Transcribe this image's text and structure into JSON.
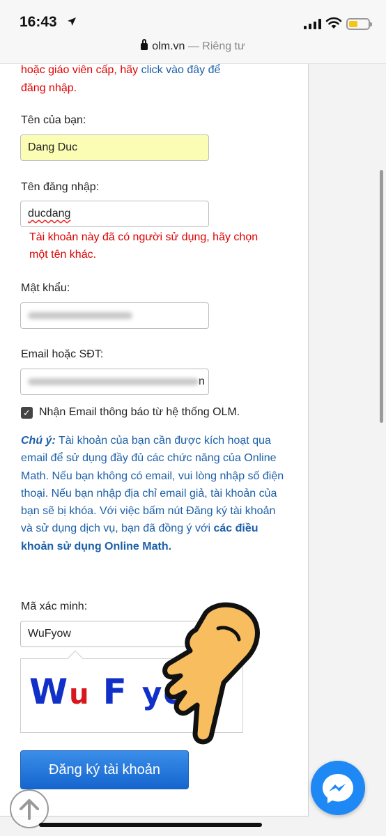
{
  "status": {
    "time": "16:43"
  },
  "browser": {
    "domain": "olm.vn",
    "suffix": "— Riêng tư"
  },
  "form": {
    "intro_prefix": "hoặc giáo viên cấp, hãy ",
    "intro_link": "click vào đây để",
    "intro_line2": "đăng nhập.",
    "name_label": "Tên của bạn:",
    "name_value": "Dang Duc",
    "username_label": "Tên đăng nhập:",
    "username_value": "ducdang",
    "username_error": "Tài khoản này đã có người sử dụng, hãy chọn một tên khác.",
    "password_label": "Mật khẩu:",
    "email_label": "Email hoặc SĐT:",
    "email_visible_tail": "n",
    "newsletter_label": "Nhận Email thông báo từ hệ thống OLM.",
    "note_title": "Chú ý:",
    "note_body": " Tài khoản của bạn cần được kích hoạt qua email để sử dụng đầy đủ các chức năng của Online Math. Nếu bạn không có email, vui lòng nhập số điện thoại. Nếu bạn nhập địa chỉ email giả, tài khoản của bạn sẽ bị khóa. Với việc bấm nút Đăng ký tài khoản và sử dụng dịch vụ, bạn đã đồng ý với ",
    "note_terms": "các điều khoản sử dụng Online Math.",
    "captcha_label": "Mã xác minh:",
    "captcha_value": "WuFyow",
    "captcha_chars": [
      "W",
      "u",
      "F",
      "y",
      "o"
    ],
    "submit_label": "Đăng ký tài khoản"
  },
  "colors": {
    "error": "#e00000",
    "note": "#1b5fa8",
    "button": "#1e6fd9",
    "messenger": "#1e88f5"
  },
  "icons": [
    "location-arrow-icon",
    "signal-icon",
    "wifi-icon",
    "battery-icon",
    "lock-icon",
    "checkbox-checked-icon",
    "messenger-icon",
    "scroll-top-icon",
    "pointing-hand-icon"
  ]
}
